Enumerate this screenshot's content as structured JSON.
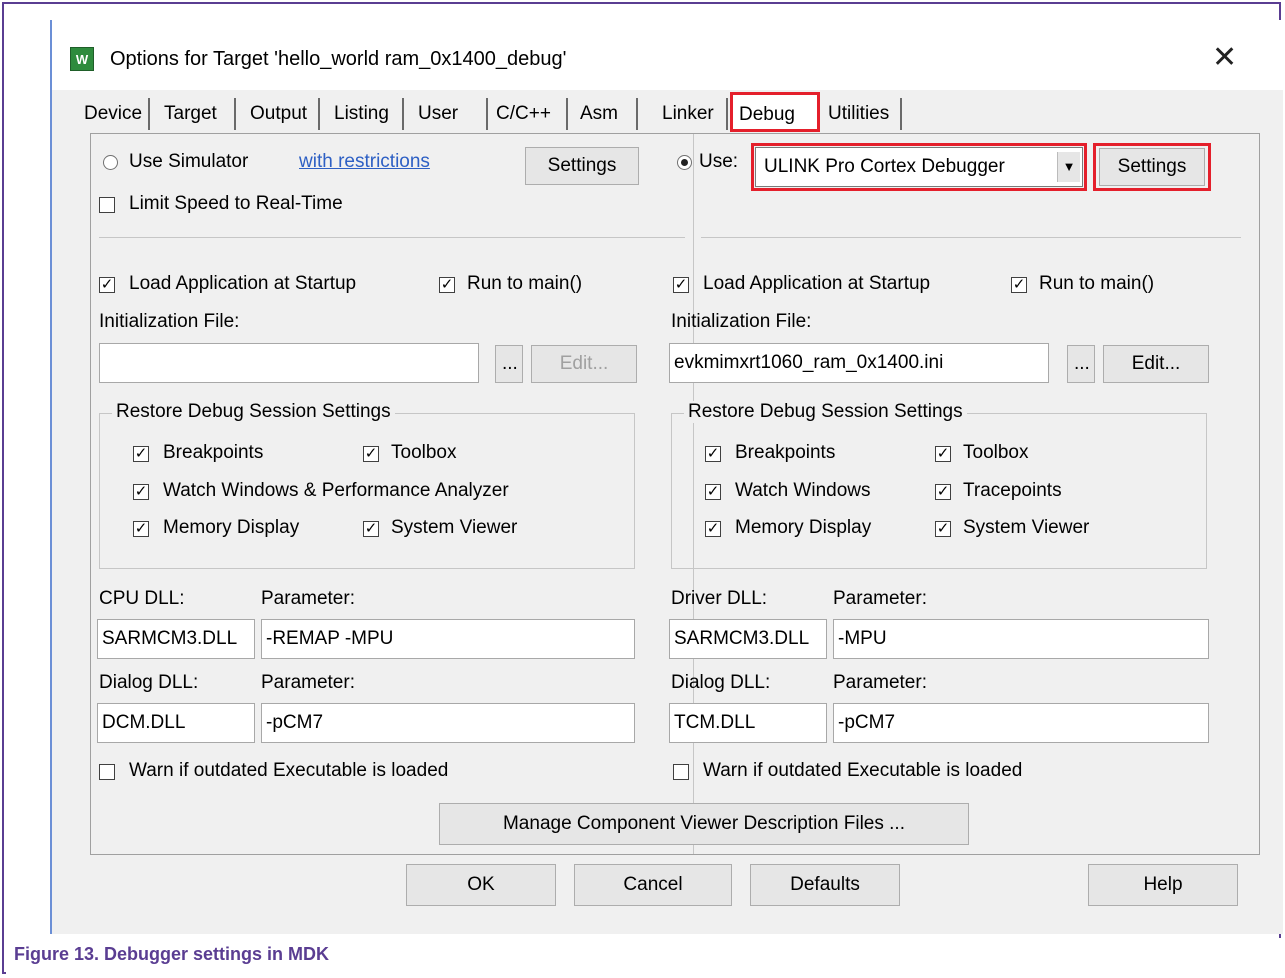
{
  "window": {
    "title": "Options for Target 'hello_world ram_0x1400_debug'",
    "close_glyph": "✕",
    "icon": "uvision-app-icon"
  },
  "tabs": [
    "Device",
    "Target",
    "Output",
    "Listing",
    "User",
    "C/C++",
    "Asm",
    "Linker",
    "Debug",
    "Utilities"
  ],
  "active_tab": "Debug",
  "left": {
    "use_simulator_label": "Use Simulator",
    "restrictions_link": "with restrictions",
    "settings_label": "Settings",
    "limit_speed_label": "Limit Speed to Real-Time",
    "load_app_label": "Load Application at Startup",
    "run_to_main_label": "Run to main()",
    "init_file_label": "Initialization File:",
    "init_file_value": "",
    "browse_label": "...",
    "edit_label": "Edit...",
    "restore_group_label": "Restore Debug Session Settings",
    "restore_items": [
      "Breakpoints",
      "Toolbox",
      "Watch Windows & Performance Analyzer",
      "Memory Display",
      "System Viewer"
    ],
    "cpu_dll_label": "CPU DLL:",
    "parameter_label": "Parameter:",
    "cpu_dll_value": "SARMCM3.DLL",
    "cpu_param_value": "-REMAP -MPU",
    "dialog_dll_label": "Dialog DLL:",
    "dialog_dll_value": "DCM.DLL",
    "dialog_param_value": "-pCM7",
    "warn_label": "Warn if outdated Executable is loaded"
  },
  "right": {
    "use_label": "Use:",
    "debugger_value": "ULINK Pro Cortex Debugger",
    "settings_label": "Settings",
    "load_app_label": "Load Application at Startup",
    "run_to_main_label": "Run to main()",
    "init_file_label": "Initialization File:",
    "init_file_value": "evkmimxrt1060_ram_0x1400.ini",
    "browse_label": "...",
    "edit_label": "Edit...",
    "restore_group_label": "Restore Debug Session Settings",
    "restore_items": [
      "Breakpoints",
      "Toolbox",
      "Watch Windows",
      "Tracepoints",
      "Memory Display",
      "System Viewer"
    ],
    "driver_dll_label": "Driver DLL:",
    "parameter_label": "Parameter:",
    "driver_dll_value": "SARMCM3.DLL",
    "driver_param_value": "-MPU",
    "dialog_dll_label": "Dialog DLL:",
    "dialog_dll_value": "TCM.DLL",
    "dialog_param_value": "-pCM7",
    "warn_label": "Warn if outdated Executable is loaded"
  },
  "manage_button_label": "Manage Component Viewer Description Files ...",
  "footer": {
    "ok": "OK",
    "cancel": "Cancel",
    "defaults": "Defaults",
    "help": "Help"
  },
  "caption": "Figure 13. Debugger settings in MDK",
  "colors": {
    "highlight": "#e41f2b",
    "frame": "#5a3d92",
    "link": "#2d5fc4"
  }
}
